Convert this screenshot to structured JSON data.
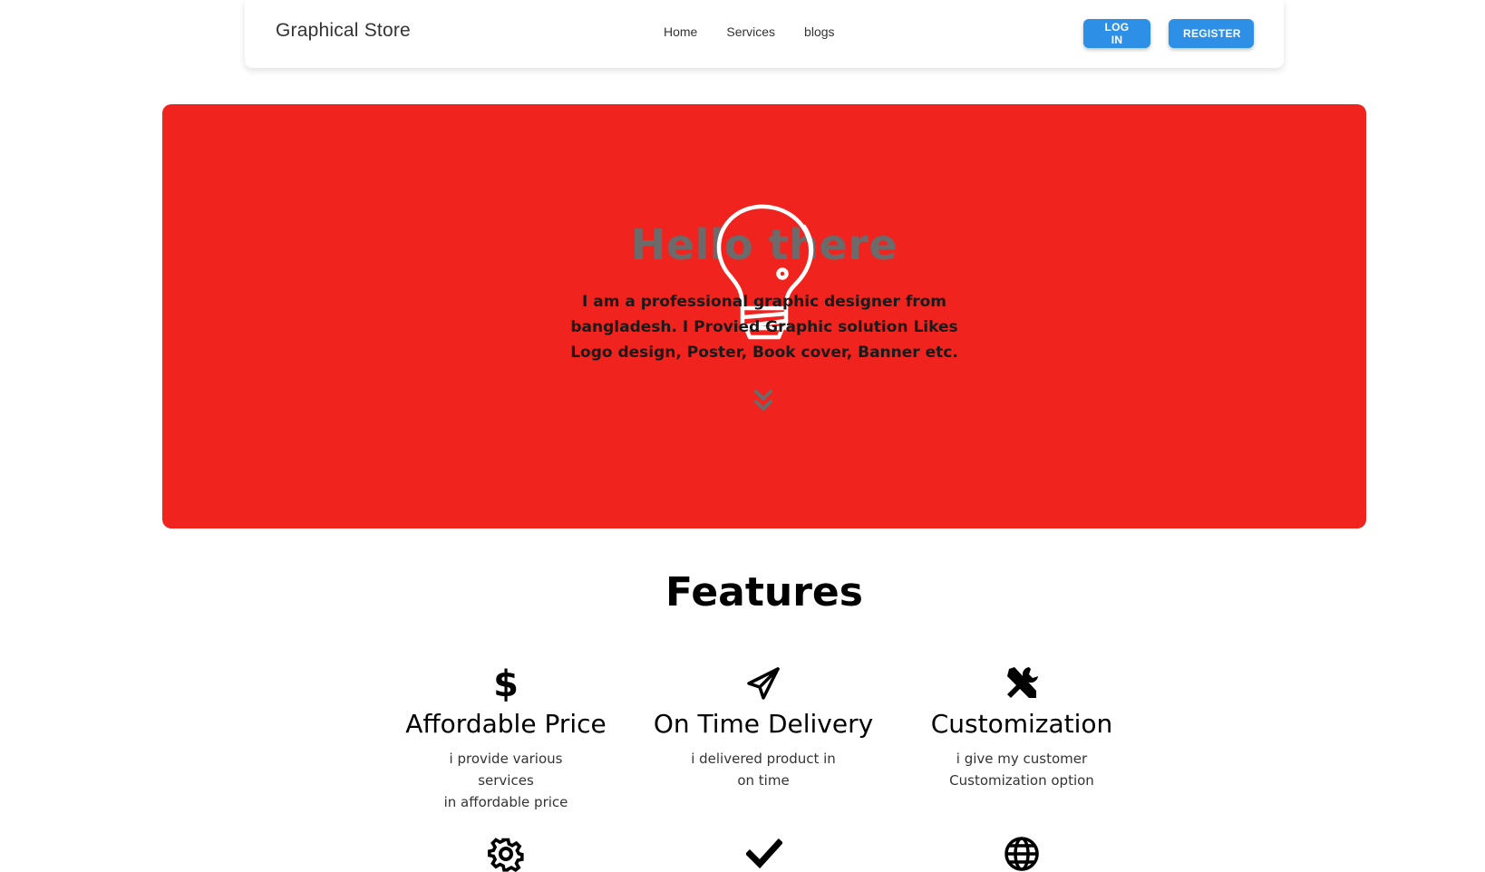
{
  "navbar": {
    "brand": "Graphical Store",
    "links": [
      "Home",
      "Services",
      "blogs"
    ],
    "login_label": "LOG IN",
    "register_label": "REGISTER",
    "button_color": "#2d8fe6"
  },
  "hero": {
    "title": "Hello there",
    "description": "I am a professional graphic designer from bangladesh. I Provied Graphic solution Likes Logo design, Poster, Book cover, Banner etc.",
    "background_color": "#f0231e",
    "icon": "lightbulb-icon",
    "scroll_icon": "double-chevron-down-icon"
  },
  "features": {
    "title": "Features",
    "items": [
      {
        "icon": "dollar-icon",
        "title": "Affordable Price",
        "desc_line1": "i provide various services",
        "desc_line2": "in affordable price"
      },
      {
        "icon": "paper-plane-icon",
        "title": "On Time Delivery",
        "desc_line1": "i delivered product in",
        "desc_line2": "on time"
      },
      {
        "icon": "tools-icon",
        "title": "Customization",
        "desc_line1": "i give my customer",
        "desc_line2": "Customization option"
      }
    ],
    "row2_icons": [
      "gear-icon",
      "checkmark-icon",
      "globe-icon"
    ]
  }
}
